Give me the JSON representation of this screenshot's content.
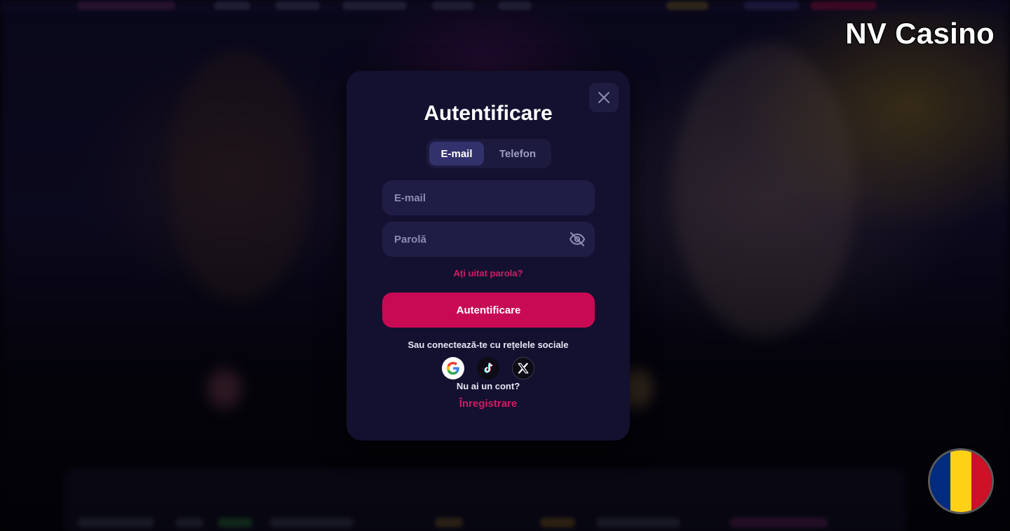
{
  "brand": {
    "text": "NV Casino"
  },
  "modal": {
    "title": "Autentificare",
    "tabs": [
      {
        "label": "E-mail",
        "active": true
      },
      {
        "label": "Telefon",
        "active": false
      }
    ],
    "email_field": {
      "placeholder": "E-mail",
      "value": ""
    },
    "password_field": {
      "placeholder": "Parolă",
      "value": "",
      "icon": "eye-off-icon"
    },
    "forgot_password": "Ați uitat parola?",
    "submit_label": "Autentificare",
    "social_text": "Sau conectează-te cu rețelele sociale",
    "social_providers": [
      {
        "name": "google",
        "icon": "google-icon"
      },
      {
        "name": "tiktok",
        "icon": "tiktok-icon"
      },
      {
        "name": "x",
        "icon": "x-icon"
      }
    ],
    "no_account": "Nu ai un cont?",
    "register_label": "Înregistrare"
  },
  "language_flag": {
    "icon": "romania-flag-icon",
    "colors": [
      "#002b7f",
      "#fcd116",
      "#ce1126"
    ]
  },
  "colors": {
    "modal_bg": "#13112f",
    "accent": "#c80a55",
    "link": "#d41b66",
    "field_bg": "#1f1d45"
  }
}
